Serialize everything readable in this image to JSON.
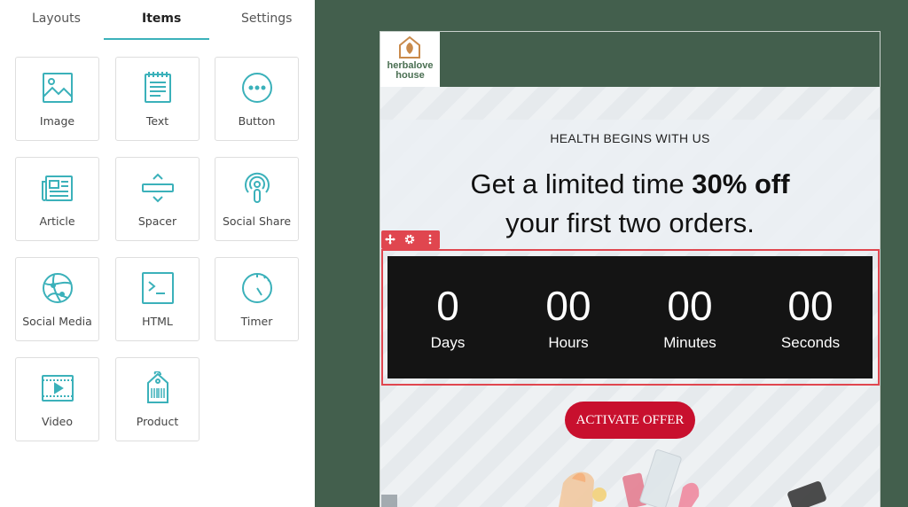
{
  "tabs": [
    {
      "label": "Layouts"
    },
    {
      "label": "Items"
    },
    {
      "label": "Settings"
    }
  ],
  "items": [
    {
      "label": "Image",
      "icon": "image-icon"
    },
    {
      "label": "Text",
      "icon": "text-icon"
    },
    {
      "label": "Button",
      "icon": "button-icon"
    },
    {
      "label": "Article",
      "icon": "article-icon"
    },
    {
      "label": "Spacer",
      "icon": "spacer-icon"
    },
    {
      "label": "Social Share",
      "icon": "social-share-icon"
    },
    {
      "label": "Social Media",
      "icon": "social-media-icon"
    },
    {
      "label": "HTML",
      "icon": "html-icon"
    },
    {
      "label": "Timer",
      "icon": "timer-icon"
    },
    {
      "label": "Video",
      "icon": "video-icon"
    },
    {
      "label": "Product",
      "icon": "product-icon"
    }
  ],
  "email": {
    "logo_line1": "herbalove",
    "logo_line2": "house",
    "eyebrow": "HEALTH BEGINS WITH US",
    "headline_pre": "Get a limited time ",
    "headline_bold": "30% off",
    "headline_line2": "your first two orders.",
    "timer": [
      {
        "value": "0",
        "caption": "Days"
      },
      {
        "value": "00",
        "caption": "Hours"
      },
      {
        "value": "00",
        "caption": "Minutes"
      },
      {
        "value": "00",
        "caption": "Seconds"
      }
    ],
    "cta_label": "ACTIVATE OFFER"
  },
  "colors": {
    "accent": "#3bb1ba",
    "canvas_bg": "#435f4d",
    "selection": "#e0464f",
    "cta": "#c8102e",
    "timer_bg": "#141414"
  }
}
